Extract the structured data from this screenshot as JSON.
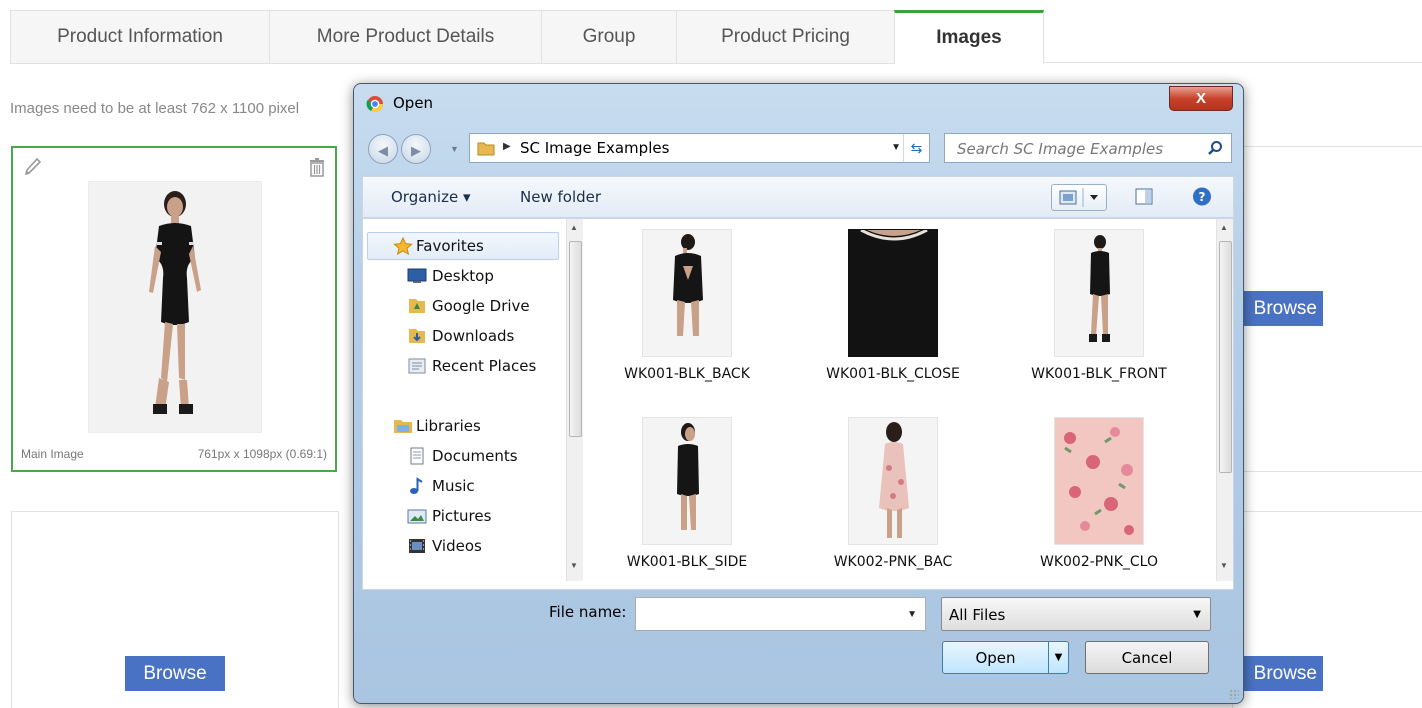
{
  "tabs": [
    {
      "label": "Product Information",
      "active": false
    },
    {
      "label": "More Product Details",
      "active": false
    },
    {
      "label": "Group",
      "active": false
    },
    {
      "label": "Product Pricing",
      "active": false
    },
    {
      "label": "Images",
      "active": true
    }
  ],
  "notice": "Images need to be at least 762 x 1100 pixel",
  "main_card": {
    "label": "Main Image",
    "dimensions": "761px x 1098px (0.69:1)",
    "edit_icon": "pencil-icon",
    "delete_icon": "trash-icon"
  },
  "browse_label": "Browse",
  "browse_partial": "Browse",
  "dialog": {
    "title": "Open",
    "close_label": "X",
    "path": "SC Image Examples",
    "search_placeholder": "Search SC Image Examples",
    "organize_label": "Organize ▾",
    "new_folder_label": "New folder",
    "nav": {
      "favorites_label": "Favorites",
      "favorites": [
        "Desktop",
        "Google Drive",
        "Downloads",
        "Recent Places"
      ],
      "libraries_label": "Libraries",
      "libraries": [
        "Documents",
        "Music",
        "Pictures",
        "Videos"
      ]
    },
    "files": [
      {
        "name": "WK001-BLK_BACK",
        "kind": "black-dress-back"
      },
      {
        "name": "WK001-BLK_CLOSE",
        "kind": "black-close"
      },
      {
        "name": "WK001-BLK_FRONT",
        "kind": "black-dress-front"
      },
      {
        "name": "WK001-BLK_SIDE",
        "kind": "black-dress-side"
      },
      {
        "name": "WK002-PNK_BAC",
        "kind": "pink-dress-back"
      },
      {
        "name": "WK002-PNK_CLO",
        "kind": "pink-floral-close"
      }
    ],
    "file_name_label": "File name:",
    "file_name_value": "",
    "file_type": "All Files",
    "open_label": "Open",
    "cancel_label": "Cancel"
  },
  "colors": {
    "accent_green": "#3aa23a",
    "browse_blue": "#4a72c4"
  }
}
